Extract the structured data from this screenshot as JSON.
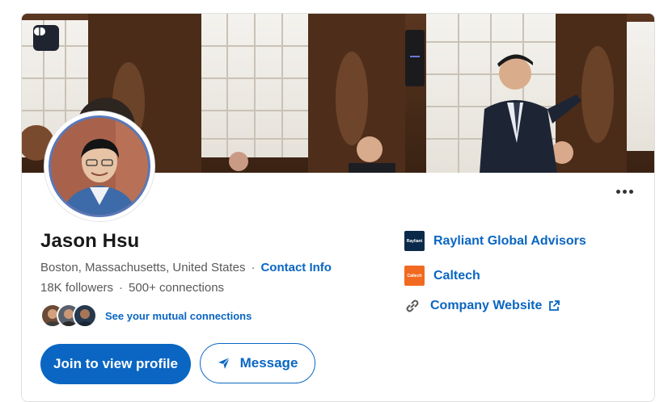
{
  "profile": {
    "name": "Jason Hsu",
    "location": "Boston, Massachusetts, United States",
    "separator": "·",
    "contact_info_label": "Contact Info",
    "followers": "18K followers",
    "connections": "500+ connections",
    "mutual_label": "See your mutual connections"
  },
  "actions": {
    "join_label": "Join to view profile",
    "message_label": "Message"
  },
  "experience": [
    {
      "name": "Rayliant Global Advisors",
      "logo_text": "Rayliant",
      "logo_color": "#0b2a4a"
    },
    {
      "name": "Caltech",
      "logo_text": "Caltech",
      "logo_color": "#f26a21"
    }
  ],
  "website": {
    "label": "Company Website"
  },
  "colors": {
    "accent": "#0a66c2",
    "text_secondary": "#595959"
  },
  "icons": [
    "ai-brain-icon",
    "more-options-icon",
    "send-icon",
    "link-icon",
    "external-link-icon"
  ]
}
